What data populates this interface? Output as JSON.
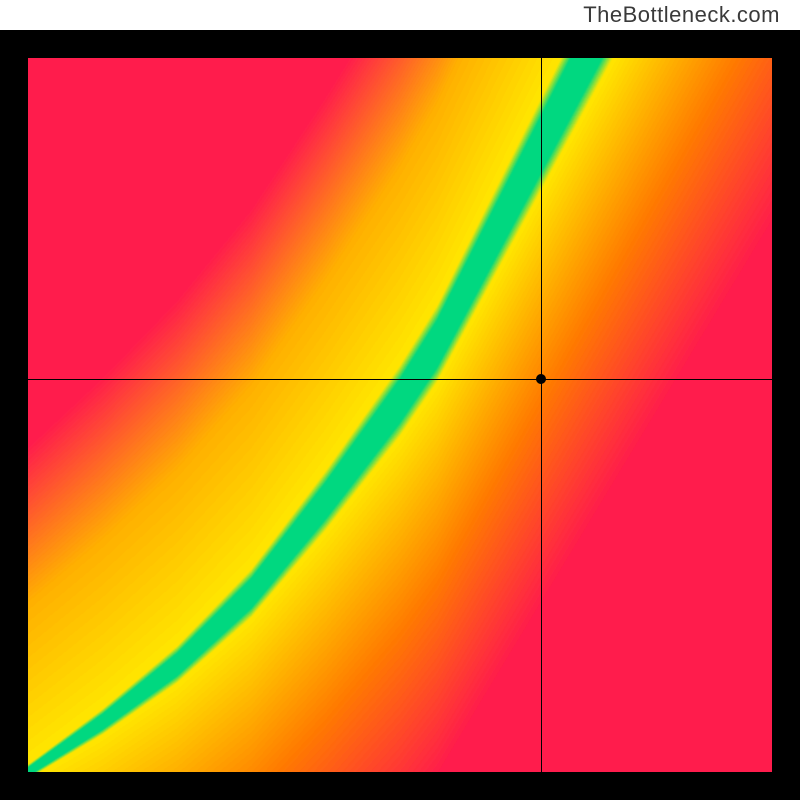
{
  "watermark": "TheBottleneck.com",
  "chart_data": {
    "type": "heatmap",
    "title": "",
    "xlabel": "",
    "ylabel": "",
    "xlim": [
      0,
      100
    ],
    "ylim": [
      0,
      100
    ],
    "marker": {
      "x": 69,
      "y": 55
    },
    "crosshair": {
      "x": 69,
      "y": 55
    },
    "optimal_curve": [
      {
        "x": 0,
        "y": 0
      },
      {
        "x": 10,
        "y": 7
      },
      {
        "x": 20,
        "y": 15
      },
      {
        "x": 30,
        "y": 25
      },
      {
        "x": 40,
        "y": 38
      },
      {
        "x": 50,
        "y": 52
      },
      {
        "x": 55,
        "y": 60
      },
      {
        "x": 60,
        "y": 70
      },
      {
        "x": 65,
        "y": 80
      },
      {
        "x": 70,
        "y": 90
      },
      {
        "x": 75,
        "y": 100
      }
    ],
    "colormap": {
      "far_low": "#ff1a4d",
      "mid_low": "#ff7a00",
      "near": "#ffe600",
      "optimal": "#00d880",
      "far_high": "#ff1a4d"
    },
    "grid": false,
    "legend": false
  }
}
